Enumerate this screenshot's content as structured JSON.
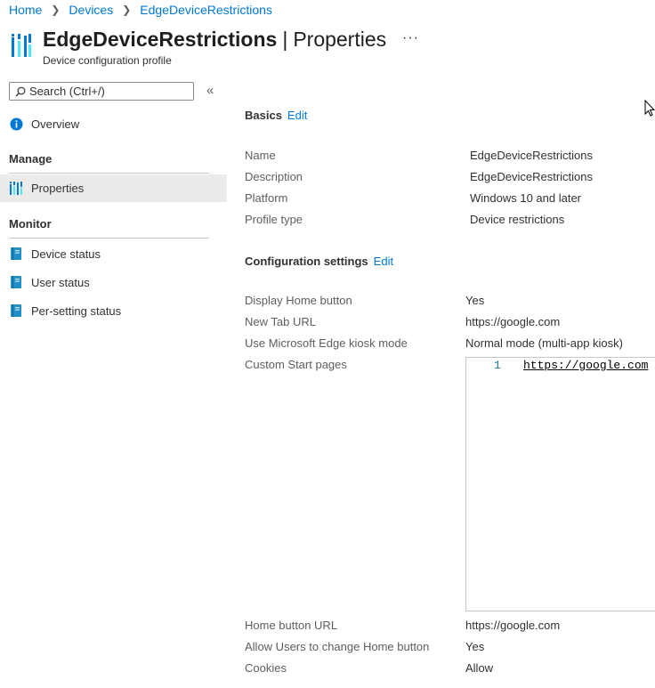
{
  "breadcrumb": {
    "items": [
      "Home",
      "Devices",
      "EdgeDeviceRestrictions"
    ]
  },
  "header": {
    "title": "EdgeDeviceRestrictions",
    "separator": "|",
    "page": "Properties",
    "more_label": "···",
    "subtitle": "Device configuration profile"
  },
  "search": {
    "placeholder": "Search (Ctrl+/)"
  },
  "sidebar": {
    "collapse_label": "«",
    "overview": "Overview",
    "manage_heading": "Manage",
    "properties": "Properties",
    "monitor_heading": "Monitor",
    "device_status": "Device status",
    "user_status": "User status",
    "per_setting_status": "Per-setting status"
  },
  "basics": {
    "title": "Basics",
    "edit_label": "Edit",
    "rows": [
      {
        "label": "Name",
        "value": "EdgeDeviceRestrictions"
      },
      {
        "label": "Description",
        "value": "EdgeDeviceRestrictions"
      },
      {
        "label": "Platform",
        "value": "Windows 10 and later"
      },
      {
        "label": "Profile type",
        "value": "Device restrictions"
      }
    ]
  },
  "config": {
    "title": "Configuration settings",
    "edit_label": "Edit",
    "rows": [
      {
        "label": "Display Home button",
        "value": "Yes"
      },
      {
        "label": "New Tab URL",
        "value": "https://google.com"
      },
      {
        "label": "Use Microsoft Edge kiosk mode",
        "value": "Normal mode (multi-app kiosk)"
      },
      {
        "label": "Custom Start pages",
        "value": ""
      },
      {
        "label": "Home button URL",
        "value": "https://google.com"
      },
      {
        "label": "Allow Users to change Home button",
        "value": "Yes"
      },
      {
        "label": "Cookies",
        "value": "Allow"
      }
    ],
    "editor": {
      "line_number": "1",
      "line_text": "https://google.com"
    }
  },
  "colors": {
    "accent": "#0078d4",
    "nav_active_bg": "#edebe9",
    "info_blue": "#0078d4",
    "book_teal": "#1f8fc7"
  }
}
